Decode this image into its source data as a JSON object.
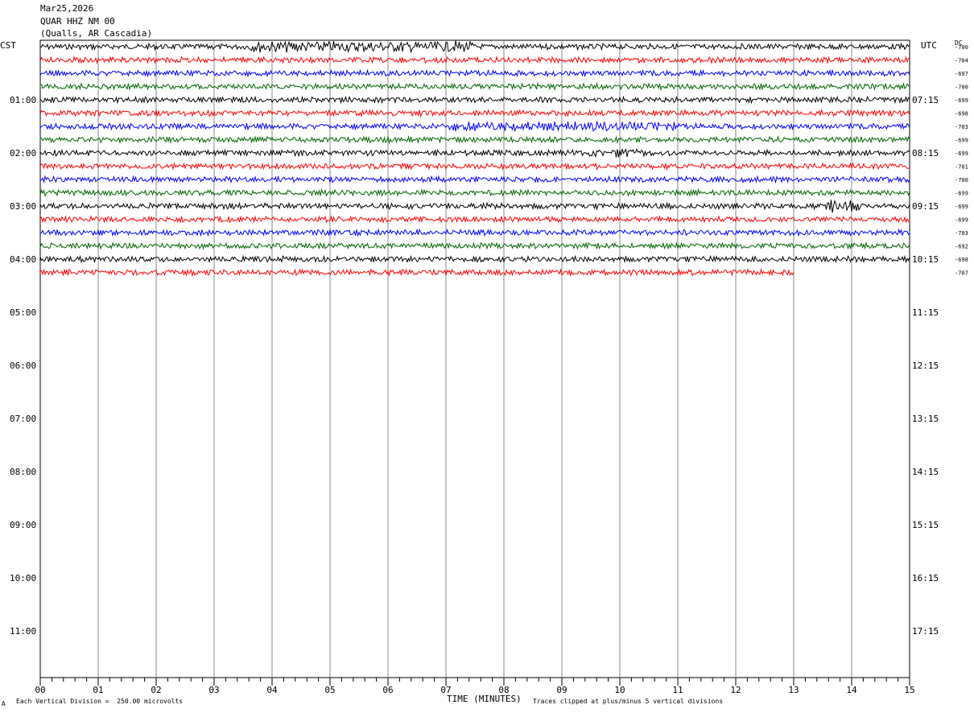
{
  "header": {
    "date": "Mar25,2026",
    "station": "QUAR HHZ NM 00",
    "location": "(Qualls, AR Cascadia)"
  },
  "left_timezone": "CST",
  "right_timezone": "UTC",
  "dc_label": "DC",
  "footer": {
    "division_note": "Each Vertical Division =  250.00 microvolts",
    "xlabel": "TIME (MINUTES)",
    "clip_note": "Traces clipped at plus/minus 5 vertical divisions",
    "corner_mark": "A"
  },
  "chart_data": {
    "type": "line",
    "title": "QUAR HHZ NM 00",
    "xlabel": "TIME (MINUTES)",
    "x_ticks": [
      "00",
      "01",
      "02",
      "03",
      "04",
      "05",
      "06",
      "07",
      "08",
      "09",
      "10",
      "11",
      "12",
      "13",
      "14",
      "15"
    ],
    "xlim": [
      0,
      15
    ],
    "left_hour_labels": [
      "01:00",
      "02:00",
      "03:00",
      "04:00",
      "05:00",
      "06:00",
      "07:00",
      "08:00",
      "09:00",
      "10:00",
      "11:00"
    ],
    "right_hour_labels": [
      "07:15",
      "08:15",
      "09:15",
      "10:15",
      "11:15",
      "12:15",
      "13:15",
      "14:15",
      "15:15",
      "16:15",
      "17:15"
    ],
    "trace_colors": [
      "#000000",
      "#ff0000",
      "#0000ff",
      "#006400"
    ],
    "dc_offsets": [
      -700,
      -704,
      -697,
      -700,
      -699,
      -698,
      -703,
      -699,
      -699,
      -701,
      -700,
      -699,
      -699,
      -699,
      -703,
      -692,
      -698,
      -707
    ],
    "traces_complete": 17,
    "last_trace_end_minute": 13,
    "trace_interval_minutes": 15,
    "grid": true
  }
}
